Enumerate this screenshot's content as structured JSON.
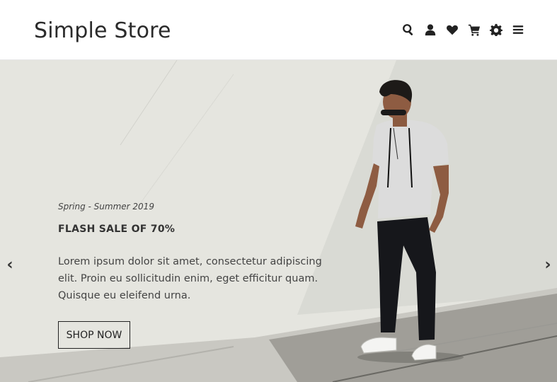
{
  "header": {
    "logo": "Simple Store",
    "icons": [
      "search-icon",
      "user-icon",
      "heart-icon",
      "cart-icon",
      "gear-icon",
      "menu-icon"
    ]
  },
  "hero": {
    "season": "Spring - Summer 2019",
    "title": "FLASH SALE OF 70%",
    "description": "Lorem ipsum dolor sit amet, consectetur adipiscing elit. Proin eu sollicitudin enim, eget efficitur quam. Quisque eu eleifend urna.",
    "button_label": "SHOP NOW",
    "prev_arrow": "‹",
    "next_arrow": "›"
  },
  "colors": {
    "header_bg": "#ffffff",
    "hero_bg": "#e4e4de",
    "text": "#333333",
    "logo": "#2b2b2b"
  }
}
